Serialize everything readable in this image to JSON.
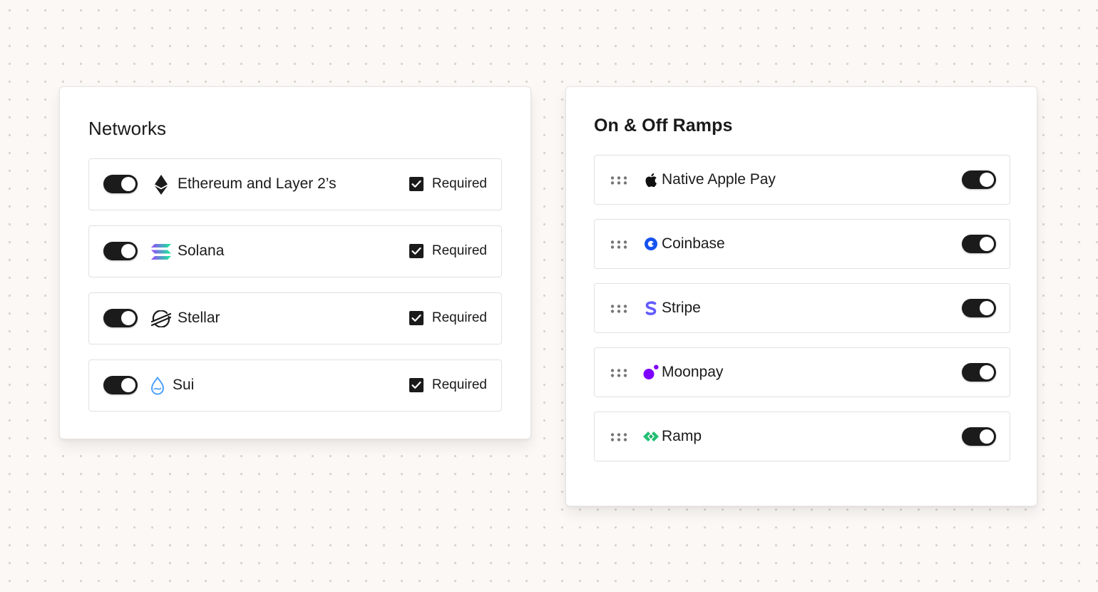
{
  "networks": {
    "title": "Networks",
    "items": [
      {
        "label": "Ethereum and Layer 2’s",
        "icon": "ethereum-icon",
        "enabled": true,
        "required_label": "Required",
        "required_checked": true
      },
      {
        "label": "Solana",
        "icon": "solana-icon",
        "enabled": true,
        "required_label": "Required",
        "required_checked": true
      },
      {
        "label": "Stellar",
        "icon": "stellar-icon",
        "enabled": true,
        "required_label": "Required",
        "required_checked": true
      },
      {
        "label": "Sui",
        "icon": "sui-icon",
        "enabled": true,
        "required_label": "Required",
        "required_checked": true
      }
    ]
  },
  "ramps": {
    "title": "On & Off Ramps",
    "items": [
      {
        "label": "Native Apple Pay",
        "icon": "apple-icon",
        "enabled": true
      },
      {
        "label": "Coinbase",
        "icon": "coinbase-icon",
        "enabled": true
      },
      {
        "label": "Stripe",
        "icon": "stripe-icon",
        "enabled": true
      },
      {
        "label": "Moonpay",
        "icon": "moonpay-icon",
        "enabled": true
      },
      {
        "label": "Ramp",
        "icon": "ramp-icon",
        "enabled": true
      }
    ]
  },
  "colors": {
    "background": "#fbf8f5",
    "toggle_on": "#1b1b1b",
    "coinbase": "#1652f0",
    "stripe": "#635bff",
    "moonpay": "#7d00ff",
    "ramp": "#21bf73",
    "sui": "#4da2ff"
  }
}
